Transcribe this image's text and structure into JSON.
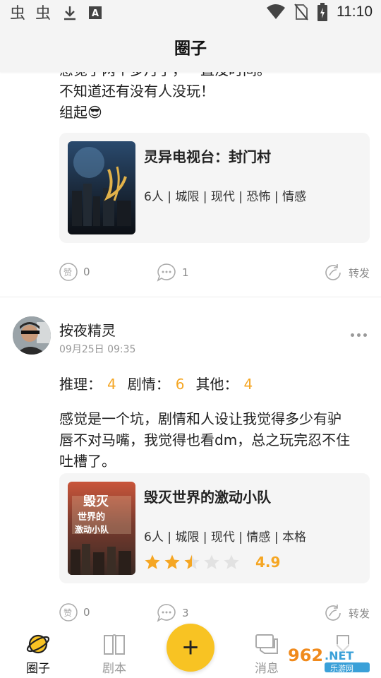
{
  "status_bar": {
    "time": "11:10",
    "left_icons": [
      "bug-icon",
      "bug-icon",
      "download-icon",
      "font-icon"
    ],
    "right_icons": [
      "wifi-icon",
      "no-sim-icon",
      "battery-charging-icon"
    ]
  },
  "header": {
    "title": "圈子"
  },
  "posts": [
    {
      "body_lines": [
        "感觉了两个多月了，一直没时间。",
        "不知道还有没有人没玩！",
        "组起😎"
      ],
      "game": {
        "title": "灵异电视台：封门村",
        "tags": "6人 | 城限 | 现代 | 恐怖 | 情感"
      },
      "likes": "0",
      "comments": "1",
      "share_label": "转发"
    },
    {
      "username": "按夜精灵",
      "time": "09月25日 09:35",
      "scores": [
        {
          "label": "推理：",
          "value": "4"
        },
        {
          "label": "剧情：",
          "value": "6"
        },
        {
          "label": "其他：",
          "value": "4"
        }
      ],
      "body_lines": [
        "感觉是一个坑，剧情和人设让我觉得多少有驴",
        "唇不对马嘴，我觉得也看dm，总之玩完忍不住",
        "吐槽了。"
      ],
      "game": {
        "title": "毁灭世界的激动小队",
        "tags": "6人 | 城限 | 现代 | 情感 | 本格",
        "rating": "4.9",
        "stars_filled": 2.5,
        "stars_total": 5
      },
      "likes": "0",
      "comments": "3",
      "share_label": "转发"
    }
  ],
  "nav": {
    "items": [
      {
        "label": "圈子",
        "icon": "planet-icon",
        "active": true
      },
      {
        "label": "剧本",
        "icon": "book-icon",
        "active": false
      },
      {
        "label": "消息",
        "icon": "message-icon",
        "active": false
      },
      {
        "label": "",
        "icon": "profile-icon",
        "active": false
      }
    ],
    "fab_label": "+"
  },
  "colors": {
    "accent": "#f8c323",
    "score": "#f5a623",
    "header_bg": "#f4f4f4"
  }
}
